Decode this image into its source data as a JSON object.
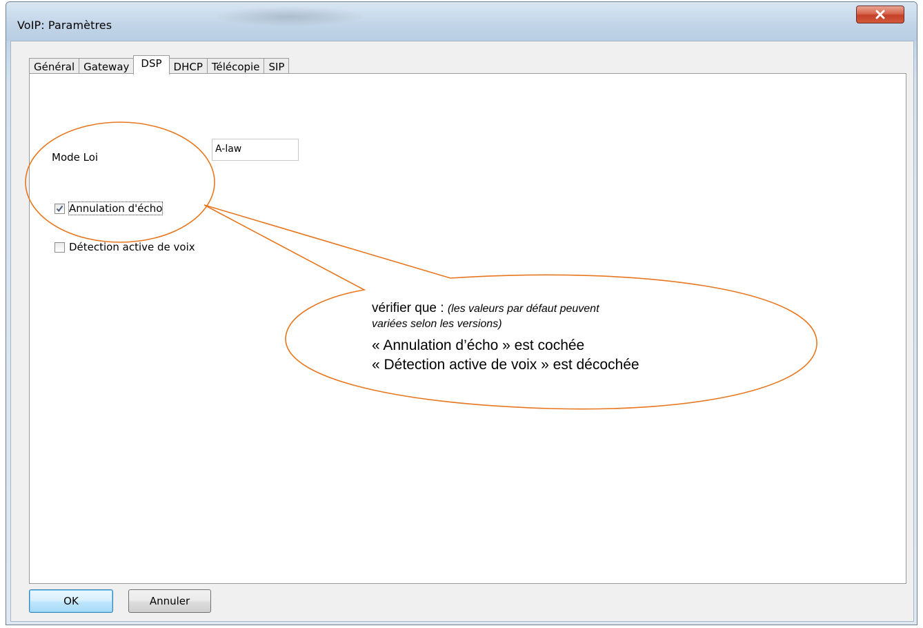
{
  "window": {
    "title": "VoIP: Paramètres",
    "close_symbol": "x"
  },
  "tabs": [
    {
      "label": "Général"
    },
    {
      "label": "Gateway"
    },
    {
      "label": "DSP"
    },
    {
      "label": "DHCP"
    },
    {
      "label": "Télécopie"
    },
    {
      "label": "SIP"
    }
  ],
  "active_tab": "DSP",
  "dsp": {
    "mode_label": "Mode Loi",
    "mode_value": "A-law",
    "echo_label": "Annulation d'écho",
    "echo_checked": true,
    "vad_label": "Détection active de voix",
    "vad_checked": false
  },
  "buttons": {
    "ok": "OK",
    "cancel": "Annuler"
  },
  "callout": {
    "intro": "vérifier que :",
    "note": "(les valeurs par défaut peuvent",
    "note2": "variées selon les versions)",
    "line1": "« Annulation d’écho » est cochée",
    "line2": "« Détection active de voix » est décochée",
    "color": "#e8761e"
  }
}
